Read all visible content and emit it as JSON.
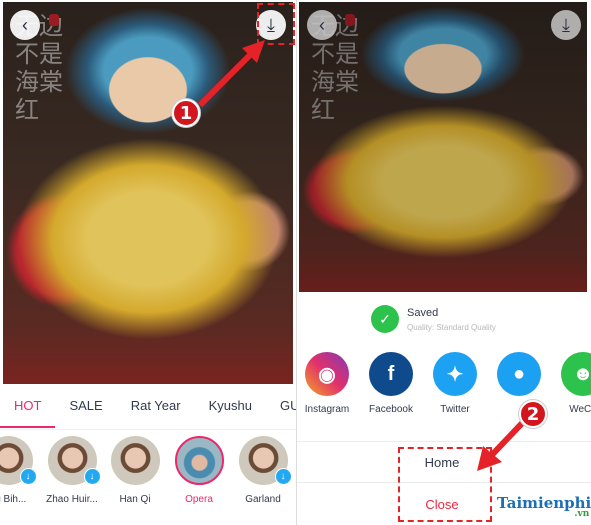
{
  "left_screen": {
    "back_icon": "chevron-left-icon",
    "download_icon": "download-icon",
    "photo_overlay_text": "无边不是海棠红",
    "tabs": [
      {
        "label": "HOT",
        "active": true
      },
      {
        "label": "SALE",
        "active": false
      },
      {
        "label": "Rat Year",
        "active": false
      },
      {
        "label": "Kyushu",
        "active": false
      },
      {
        "label": "GUOSE",
        "active": false
      }
    ],
    "filters": [
      {
        "name": "ng Bih...",
        "downloadable": true,
        "selected": false
      },
      {
        "name": "Zhao Huir...",
        "downloadable": true,
        "selected": false
      },
      {
        "name": "Han Qi",
        "downloadable": false,
        "selected": false
      },
      {
        "name": "Opera",
        "downloadable": false,
        "selected": true
      },
      {
        "name": "Garland",
        "downloadable": true,
        "selected": false
      }
    ],
    "step_marker": "1"
  },
  "right_screen": {
    "back_icon": "chevron-left-icon",
    "download_icon": "download-icon",
    "saved": {
      "title": "Saved",
      "subtitle": "Quality: Standard Quality"
    },
    "share_targets": [
      {
        "label": "Instagram",
        "icon": "instagram-icon",
        "color": "#c13584"
      },
      {
        "label": "Facebook",
        "icon": "facebook-icon",
        "color": "#0e4a8c"
      },
      {
        "label": "Twitter",
        "icon": "twitter-icon",
        "color": "#1da1f2"
      },
      {
        "label": "",
        "icon": "qq-icon",
        "color": "#1ca0f2"
      },
      {
        "label": "WeCh",
        "icon": "wechat-icon",
        "color": "#2dc24c"
      }
    ],
    "home_label": "Home",
    "close_label": "Close",
    "step_marker": "2"
  },
  "annotation": {
    "accent_color": "#e52227"
  },
  "watermark": {
    "brand": "Taimienphi",
    "tld": ".vn"
  }
}
